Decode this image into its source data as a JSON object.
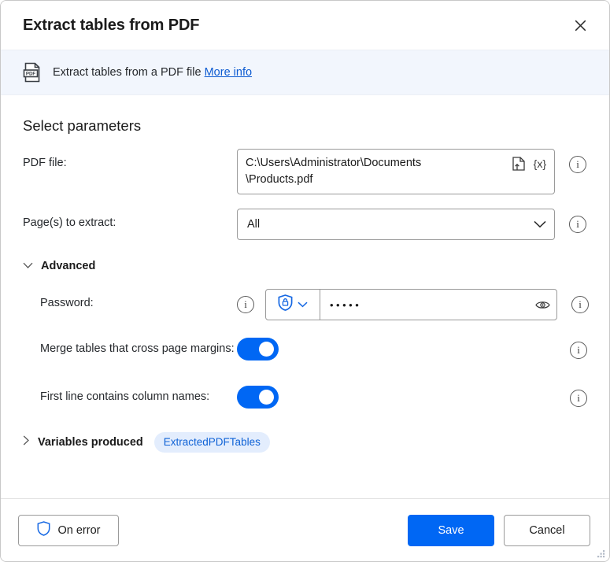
{
  "window": {
    "title": "Extract tables from PDF",
    "close_icon": "close-icon"
  },
  "banner": {
    "icon": "pdf-file-icon",
    "text": "Extract tables from a PDF file ",
    "link_label": "More info"
  },
  "main": {
    "section_title": "Select parameters",
    "pdf_file": {
      "label": "PDF file:",
      "value": "C:\\Users\\Administrator\\Documents\n\\Products.pdf",
      "file_picker_icon": "file-select-icon",
      "variable_icon": "{x}",
      "info_icon": "info-icon"
    },
    "pages": {
      "label": "Page(s) to extract:",
      "value": "All",
      "chevron_icon": "chevron-down-icon",
      "info_icon": "info-icon"
    },
    "advanced": {
      "label": "Advanced",
      "expanded": true,
      "chevron_icon": "chevron-down-icon"
    },
    "password": {
      "label": "Password:",
      "left_info_icon": "info-icon",
      "mode_icon": "shield-lock-icon",
      "mode_chevron_icon": "chevron-down-icon",
      "value": "•••••",
      "reveal_icon": "eye-icon",
      "info_icon": "info-icon"
    },
    "toggles": [
      {
        "label": "Merge tables that cross page margins:",
        "on": true,
        "info_icon": "info-icon"
      },
      {
        "label": "First line contains column names:",
        "on": true,
        "info_icon": "info-icon"
      }
    ],
    "variables_produced": {
      "label": "Variables produced",
      "expanded": false,
      "chevron_icon": "chevron-right-icon",
      "chip": "ExtractedPDFTables"
    }
  },
  "footer": {
    "on_error_label": "On error",
    "on_error_icon": "shield-icon",
    "save_label": "Save",
    "cancel_label": "Cancel",
    "resize_grip_icon": "resize-grip-icon"
  },
  "colors": {
    "accent": "#0067F4",
    "link": "#0D5BD1",
    "banner_bg": "#F2F6FD",
    "chip_bg": "#E3EDFD",
    "chip_text": "#0F62D6",
    "text": "#1B1B1B",
    "border": "#9A9A9A"
  }
}
